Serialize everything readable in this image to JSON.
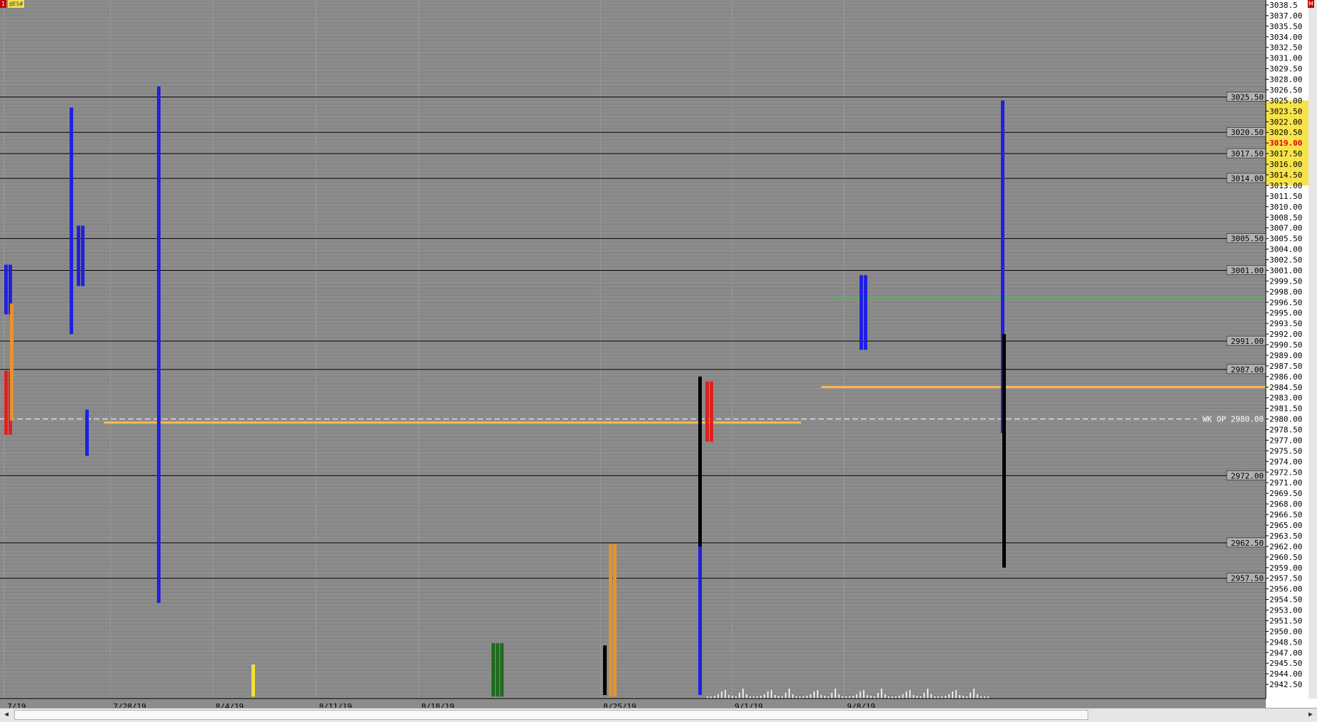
{
  "header": {
    "close_label": "1",
    "symbol": "@ES#",
    "m_label": "M"
  },
  "colors": {
    "background": "#8c8c8c",
    "grid": "#7a7a7a",
    "green": "#1f6b1f",
    "orange": "#e8922a",
    "yellow": "#f2e03c",
    "red": "#e0201e",
    "blue": "#2020e0",
    "axis_bg": "#ffffff",
    "highlight": "#f7e34b",
    "vpoc": "#ffb84d"
  },
  "chart_data": {
    "type": "table",
    "ylim": [
      2940.5,
      3039.0
    ],
    "tick_step": 1.5,
    "y_ticks_labels": [
      "3038.5",
      "3037.00",
      "3035.50",
      "3034.00",
      "3032.50",
      "3031.00",
      "3029.50",
      "3028.00",
      "3026.50",
      "3025.00",
      "3023.50",
      "3022.00",
      "3020.50",
      "3019.00",
      "3017.50",
      "3016.00",
      "3014.50",
      "3013.00",
      "3011.50",
      "3010.00",
      "3008.50",
      "3007.00",
      "3005.50",
      "3004.00",
      "3002.50",
      "3001.00",
      "2999.50",
      "2998.00",
      "2996.50",
      "2995.00",
      "2993.50",
      "2992.00",
      "2990.50",
      "2989.00",
      "2987.50",
      "2986.00",
      "2984.50",
      "2983.00",
      "2981.50",
      "2980.00",
      "2978.50",
      "2977.00",
      "2975.50",
      "2974.00",
      "2972.50",
      "2971.00",
      "2969.50",
      "2968.00",
      "2966.50",
      "2965.00",
      "2963.50",
      "2962.00",
      "2960.50",
      "2959.00",
      "2957.50",
      "2956.00",
      "2954.50",
      "2953.00",
      "2951.50",
      "2950.00",
      "2948.50",
      "2947.00",
      "2945.50",
      "2944.00",
      "2942.50"
    ],
    "highlight_range": [
      3013.0,
      3025.0
    ],
    "current_price": "3019.00",
    "x_labels": [
      {
        "label": "7/19",
        "x": 0.0
      },
      {
        "label": "7/28/19",
        "x": 0.084
      },
      {
        "label": "8/4/19",
        "x": 0.165
      },
      {
        "label": "8/11/19",
        "x": 0.247
      },
      {
        "label": "8/18/19",
        "x": 0.328
      },
      {
        "label": "8/25/19",
        "x": 0.472
      },
      {
        "label": "9/1/19",
        "x": 0.576
      },
      {
        "label": "9/8/19",
        "x": 0.665
      }
    ],
    "level_lines": [
      {
        "label": "3025.50",
        "price": 3025.5
      },
      {
        "label": "3020.50",
        "price": 3020.5
      },
      {
        "label": "3017.50",
        "price": 3017.5
      },
      {
        "label": "3014.00",
        "price": 3014.0
      },
      {
        "label": "3005.50",
        "price": 3005.5
      },
      {
        "label": "3001.00",
        "price": 3001.0
      },
      {
        "label": "2991.00",
        "price": 2991.0
      },
      {
        "label": "2987.00",
        "price": 2987.0
      },
      {
        "label": "WK OP 2980.00",
        "price": 2980.0
      },
      {
        "label": "2972.00",
        "price": 2972.0
      },
      {
        "label": "2962.50",
        "price": 2962.5
      },
      {
        "label": "2957.50",
        "price": 2957.5
      }
    ],
    "green_line": 2997.0,
    "vpoc_lines": [
      {
        "price": 2979.5,
        "from": 0.08,
        "to": 0.632
      },
      {
        "price": 2984.5,
        "from": 0.648,
        "to": 1.0
      }
    ]
  }
}
